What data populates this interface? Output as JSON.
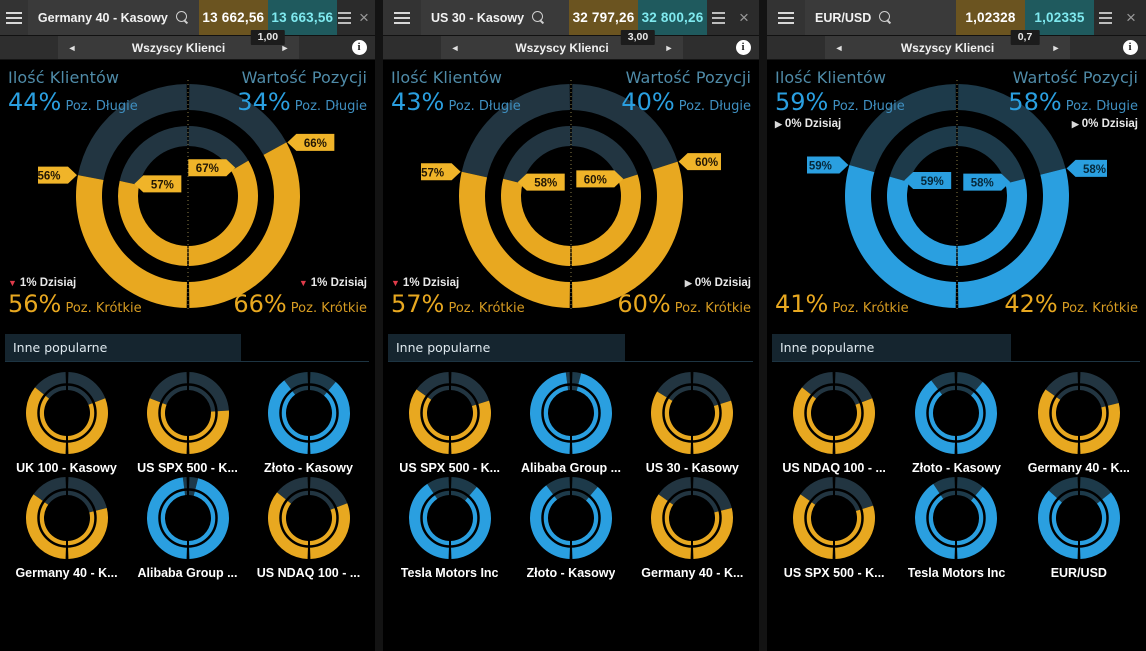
{
  "colors": {
    "long_blue": "#2a9fe0",
    "long_blue_dark": "#1d3a4a",
    "short_gold": "#e8a820",
    "short_gold_dark": "#223541",
    "accent_caption": "#4f8ba8",
    "bid_bg": "#6b5420",
    "ask_bg": "#1f5a5e",
    "callout_gold": "#f0b429",
    "callout_blue": "#2a9fe0",
    "pop_bar_bg": "#15252f"
  },
  "icons": {
    "menu": "hamburger-icon",
    "search": "search-icon",
    "close": "close-icon",
    "settings": "lines-icon",
    "info": "info-icon",
    "prev": "chevron-left-icon",
    "next": "chevron-right-icon"
  },
  "panels": [
    {
      "titlebar": {
        "instrument": "Germany 40 - Kasowy",
        "bid": "13 662,56",
        "ask": "13 663,56",
        "spread": "1,00",
        "close_label": "×"
      },
      "subbar": {
        "prev": "◄",
        "title": "Wszyscy Klienci",
        "next": "►",
        "info": "i"
      },
      "sentiment": {
        "clients_caption": "Ilość Klientów",
        "value_caption": "Wartość Pozycji",
        "long_label": "Poz. Długie",
        "short_label": "Poz. Krótkie",
        "clients_long": "44%",
        "value_long": "34%",
        "clients_short": "56%",
        "value_short": "66%",
        "clients_today": "1% Dzisiaj",
        "value_today": "1% Dzisiaj",
        "clients_today_dir": "down",
        "value_today_dir": "down",
        "today_position": "bottom",
        "outer_left_pct": 56,
        "outer_right_pct": 66,
        "inner_left_pct": 57,
        "inner_right_pct": 67,
        "dominant": "short",
        "callouts": {
          "outer_left": "56%",
          "outer_right": "66%",
          "inner_left": "57%",
          "inner_right": "67%"
        }
      },
      "popular": {
        "header": "Inne popularne",
        "tiles": [
          {
            "label": "UK 100 - Kasowy",
            "left_pct": 72,
            "right_pct": 62,
            "left_inner": 68,
            "right_inner": 58,
            "left_side": "short",
            "right_side": "short"
          },
          {
            "label": "US SPX 500 - K...",
            "left_pct": 62,
            "right_pct": 52,
            "left_inner": 60,
            "right_inner": 50,
            "left_side": "short",
            "right_side": "short"
          },
          {
            "label": "Złoto - Kasowy",
            "left_pct": 80,
            "right_pct": 78,
            "left_inner": 78,
            "right_inner": 76,
            "left_side": "long",
            "right_side": "long"
          },
          {
            "label": "Germany 40 - K...",
            "left_pct": 70,
            "right_pct": 58,
            "left_inner": 68,
            "right_inner": 56,
            "left_side": "short",
            "right_side": "short"
          },
          {
            "label": "Alibaba Group ...",
            "left_pct": 97,
            "right_pct": 93,
            "left_inner": 95,
            "right_inner": 90,
            "left_side": "long",
            "right_side": "long"
          },
          {
            "label": "US NDAQ 100 - ...",
            "left_pct": 72,
            "right_pct": 62,
            "left_inner": 70,
            "right_inner": 60,
            "left_side": "short",
            "right_side": "short"
          }
        ]
      }
    },
    {
      "titlebar": {
        "instrument": "US 30 - Kasowy",
        "bid": "32 797,26",
        "ask": "32 800,26",
        "spread": "3,00",
        "close_label": "×"
      },
      "subbar": {
        "prev": "◄",
        "title": "Wszyscy Klienci",
        "next": "►",
        "info": "i"
      },
      "sentiment": {
        "clients_caption": "Ilość Klientów",
        "value_caption": "Wartość Pozycji",
        "long_label": "Poz. Długie",
        "short_label": "Poz. Krótkie",
        "clients_long": "43%",
        "value_long": "40%",
        "clients_short": "57%",
        "value_short": "60%",
        "clients_today": "1% Dzisiaj",
        "value_today": "0% Dzisiaj",
        "clients_today_dir": "down",
        "value_today_dir": "flat",
        "today_position": "bottom",
        "outer_left_pct": 57,
        "outer_right_pct": 60,
        "inner_left_pct": 58,
        "inner_right_pct": 60,
        "dominant": "short",
        "callouts": {
          "outer_left": "57%",
          "outer_right": "60%",
          "inner_left": "58%",
          "inner_right": "60%"
        }
      },
      "popular": {
        "header": "Inne popularne",
        "tiles": [
          {
            "label": "US SPX 500 - K...",
            "left_pct": 70,
            "right_pct": 60,
            "left_inner": 68,
            "right_inner": 58,
            "left_side": "short",
            "right_side": "short"
          },
          {
            "label": "Alibaba Group ...",
            "left_pct": 97,
            "right_pct": 93,
            "left_inner": 95,
            "right_inner": 90,
            "left_side": "long",
            "right_side": "long"
          },
          {
            "label": "US 30 - Kasowy",
            "left_pct": 68,
            "right_pct": 60,
            "left_inner": 66,
            "right_inner": 58,
            "left_side": "short",
            "right_side": "short"
          },
          {
            "label": "Tesla Motors Inc",
            "left_pct": 82,
            "right_pct": 78,
            "left_inner": 80,
            "right_inner": 76,
            "left_side": "long",
            "right_side": "long"
          },
          {
            "label": "Złoto - Kasowy",
            "left_pct": 80,
            "right_pct": 78,
            "left_inner": 78,
            "right_inner": 76,
            "left_side": "long",
            "right_side": "long"
          },
          {
            "label": "Germany 40 - K...",
            "left_pct": 70,
            "right_pct": 58,
            "left_inner": 68,
            "right_inner": 56,
            "left_side": "short",
            "right_side": "short"
          }
        ]
      }
    },
    {
      "titlebar": {
        "instrument": "EUR/USD",
        "bid": "1,02328",
        "ask": "1,02335",
        "spread": "0,7",
        "close_label": "×"
      },
      "subbar": {
        "prev": "◄",
        "title": "Wszyscy Klienci",
        "next": "►",
        "info": "i"
      },
      "sentiment": {
        "clients_caption": "Ilość Klientów",
        "value_caption": "Wartość Pozycji",
        "long_label": "Poz. Długie",
        "short_label": "Poz. Krótkie",
        "clients_long": "59%",
        "value_long": "58%",
        "clients_short": "41%",
        "value_short": "42%",
        "clients_today": "0% Dzisiaj",
        "value_today": "0% Dzisiaj",
        "clients_today_dir": "flat",
        "value_today_dir": "flat",
        "today_position": "top",
        "outer_left_pct": 59,
        "outer_right_pct": 58,
        "inner_left_pct": 59,
        "inner_right_pct": 58,
        "dominant": "long",
        "callouts": {
          "outer_left": "59%",
          "outer_right": "58%",
          "inner_left": "59%",
          "inner_right": "58%"
        }
      },
      "popular": {
        "header": "Inne popularne",
        "tiles": [
          {
            "label": "US NDAQ 100 - ...",
            "left_pct": 72,
            "right_pct": 62,
            "left_inner": 70,
            "right_inner": 60,
            "left_side": "short",
            "right_side": "short"
          },
          {
            "label": "Złoto - Kasowy",
            "left_pct": 80,
            "right_pct": 78,
            "left_inner": 78,
            "right_inner": 76,
            "left_side": "long",
            "right_side": "long"
          },
          {
            "label": "Germany 40 - K...",
            "left_pct": 70,
            "right_pct": 58,
            "left_inner": 68,
            "right_inner": 56,
            "left_side": "short",
            "right_side": "short"
          },
          {
            "label": "US SPX 500 - K...",
            "left_pct": 70,
            "right_pct": 60,
            "left_inner": 68,
            "right_inner": 58,
            "left_side": "short",
            "right_side": "short"
          },
          {
            "label": "Tesla Motors Inc",
            "left_pct": 82,
            "right_pct": 78,
            "left_inner": 80,
            "right_inner": 76,
            "left_side": "long",
            "right_side": "long"
          },
          {
            "label": "EUR/USD",
            "left_pct": 74,
            "right_pct": 72,
            "left_inner": 72,
            "right_inner": 70,
            "left_side": "long",
            "right_side": "long"
          }
        ]
      }
    }
  ],
  "chart_data": {
    "type": "pie",
    "title": "Sentyment klientów — Poz. Długie vs Poz. Krótkie",
    "legend": [
      "Poz. Długie",
      "Poz. Krótkie"
    ],
    "charts": [
      {
        "instrument": "Germany 40 - Kasowy",
        "series": [
          {
            "name": "Ilość Klientów",
            "long": 44,
            "short": 56,
            "outer_ring": 56,
            "inner_ring": 57
          },
          {
            "name": "Wartość Pozycji",
            "long": 34,
            "short": 66,
            "outer_ring": 66,
            "inner_ring": 67
          }
        ]
      },
      {
        "instrument": "US 30 - Kasowy",
        "series": [
          {
            "name": "Ilość Klientów",
            "long": 43,
            "short": 57,
            "outer_ring": 57,
            "inner_ring": 58
          },
          {
            "name": "Wartość Pozycji",
            "long": 40,
            "short": 60,
            "outer_ring": 60,
            "inner_ring": 60
          }
        ]
      },
      {
        "instrument": "EUR/USD",
        "series": [
          {
            "name": "Ilość Klientów",
            "long": 59,
            "short": 41,
            "outer_ring": 59,
            "inner_ring": 59
          },
          {
            "name": "Wartość Pozycji",
            "long": 58,
            "short": 42,
            "outer_ring": 58,
            "inner_ring": 58
          }
        ]
      }
    ]
  }
}
